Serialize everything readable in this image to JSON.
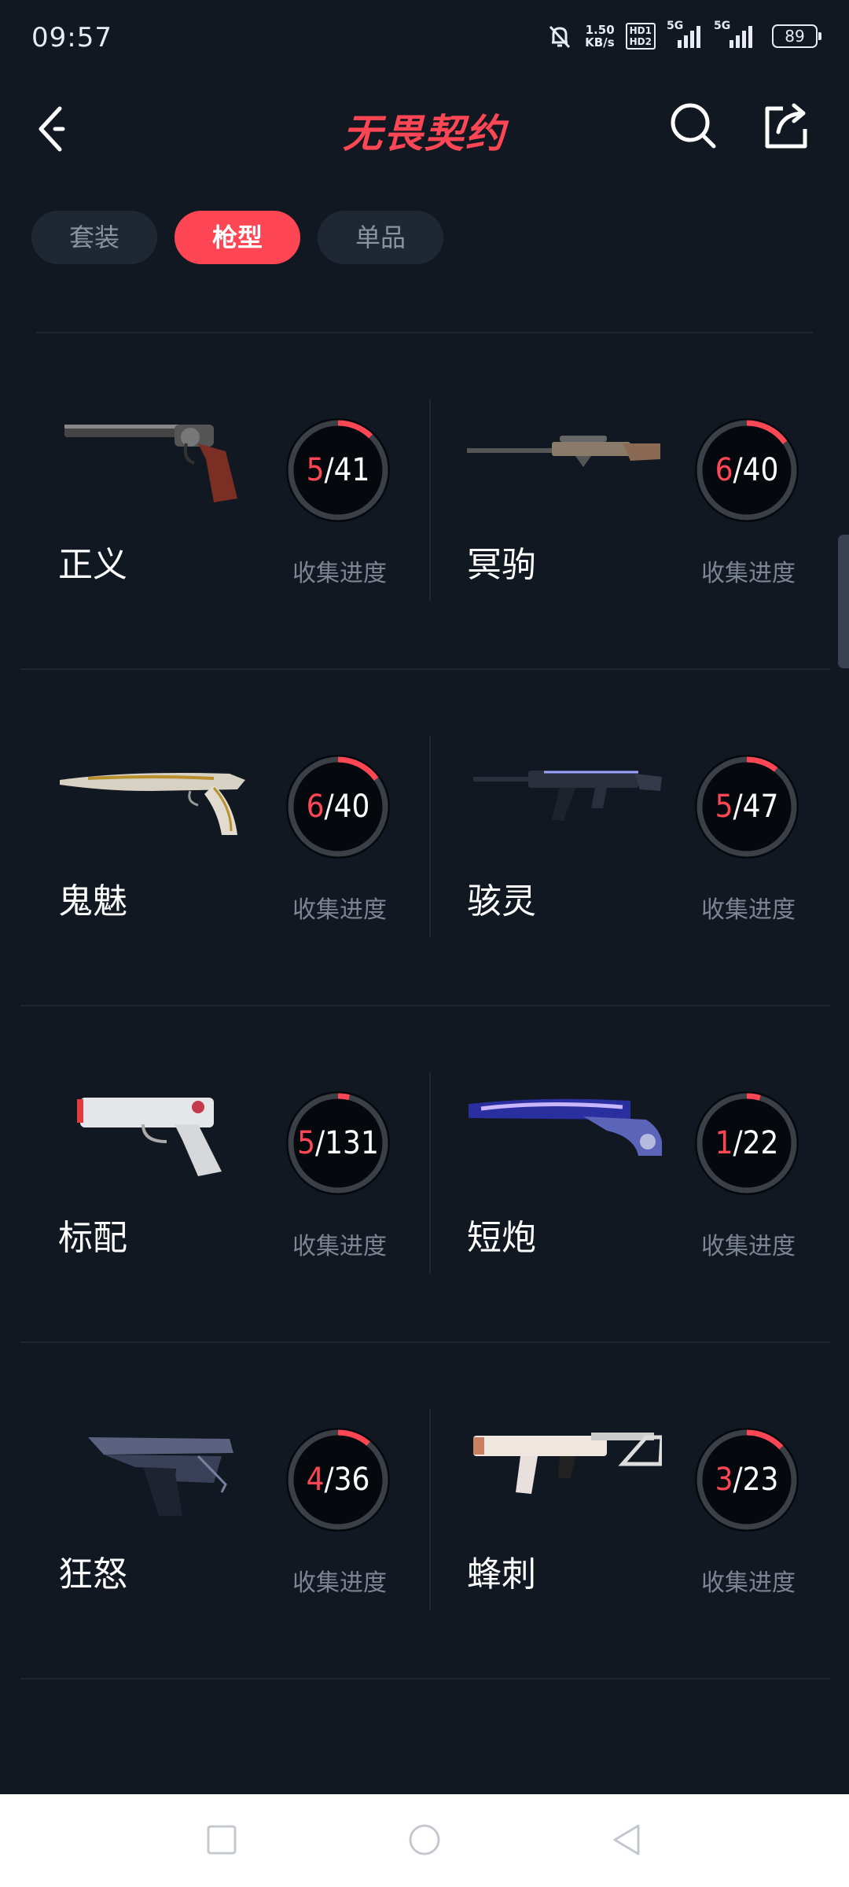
{
  "status": {
    "time": "09:57",
    "speed_value": "1.50",
    "speed_unit": "KB/s",
    "hd1": "HD1",
    "hd2": "HD2",
    "net1": "5G",
    "net2": "5G",
    "battery": "89"
  },
  "header": {
    "title": "无畏契约"
  },
  "tabs": [
    {
      "label": "套装",
      "active": false
    },
    {
      "label": "枪型",
      "active": true
    },
    {
      "label": "单品",
      "active": false
    }
  ],
  "progress_label": "收集进度",
  "weapons": [
    {
      "name": "正义",
      "owned": "5",
      "total": "/41",
      "fraction": 0.122,
      "icon": "revolver-icon"
    },
    {
      "name": "冥驹",
      "owned": "6",
      "total": "/40",
      "fraction": 0.15,
      "icon": "sniper-rifle-icon"
    },
    {
      "name": "鬼魅",
      "owned": "6",
      "total": "/40",
      "fraction": 0.15,
      "icon": "pistol-icon"
    },
    {
      "name": "骇灵",
      "owned": "5",
      "total": "/47",
      "fraction": 0.106,
      "icon": "rifle-icon"
    },
    {
      "name": "标配",
      "owned": "5",
      "total": "/131",
      "fraction": 0.038,
      "icon": "sidearm-icon"
    },
    {
      "name": "短炮",
      "owned": "1",
      "total": "/22",
      "fraction": 0.045,
      "icon": "shotgun-pistol-icon"
    },
    {
      "name": "狂怒",
      "owned": "4",
      "total": "/36",
      "fraction": 0.111,
      "icon": "machine-pistol-icon"
    },
    {
      "name": "蜂刺",
      "owned": "3",
      "total": "/23",
      "fraction": 0.13,
      "icon": "smg-icon"
    }
  ],
  "colors": {
    "accent": "#ff4655",
    "background": "#111822",
    "ring_track": "#3b3f46"
  }
}
